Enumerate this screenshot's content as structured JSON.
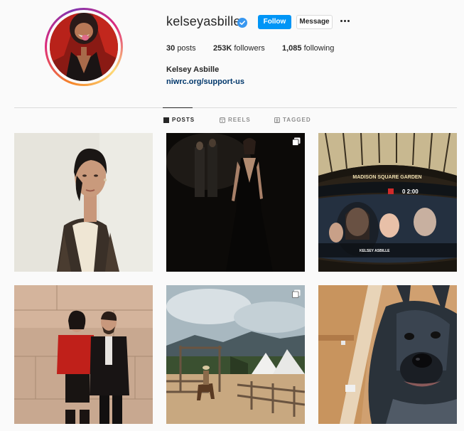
{
  "profile": {
    "username": "kelseyasbille",
    "verified": true,
    "follow_label": "Follow",
    "message_label": "Message",
    "full_name": "Kelsey Asbille",
    "link": "niwrc.org/support-us"
  },
  "stats": {
    "posts": {
      "count": "30",
      "label": "posts"
    },
    "followers": {
      "count": "253K",
      "label": "followers"
    },
    "following": {
      "count": "1,085",
      "label": "following"
    }
  },
  "tabs": [
    {
      "label": "POSTS",
      "icon": "grid-icon",
      "active": true
    },
    {
      "label": "REELS",
      "icon": "reels-icon",
      "active": false
    },
    {
      "label": "TAGGED",
      "icon": "tagged-icon",
      "active": false
    }
  ],
  "posts": [
    {
      "description": "portrait",
      "multi": false
    },
    {
      "description": "evening-gown",
      "multi": true
    },
    {
      "description": "arena-jumbotron",
      "multi": false
    },
    {
      "description": "couple-red-sweater",
      "multi": false
    },
    {
      "description": "ranch-horse",
      "multi": true
    },
    {
      "description": "dog-selfie",
      "multi": false
    }
  ],
  "arena_text": {
    "sign": "MADISON SQUARE GARDEN",
    "scoreboard": "0  2:00",
    "caption": "KELSEY ASBILLE"
  },
  "colors": {
    "accent": "#0095f6",
    "link": "#00376b",
    "text": "#262626",
    "muted": "#8e8e8e",
    "divider": "#dbdbdb"
  }
}
